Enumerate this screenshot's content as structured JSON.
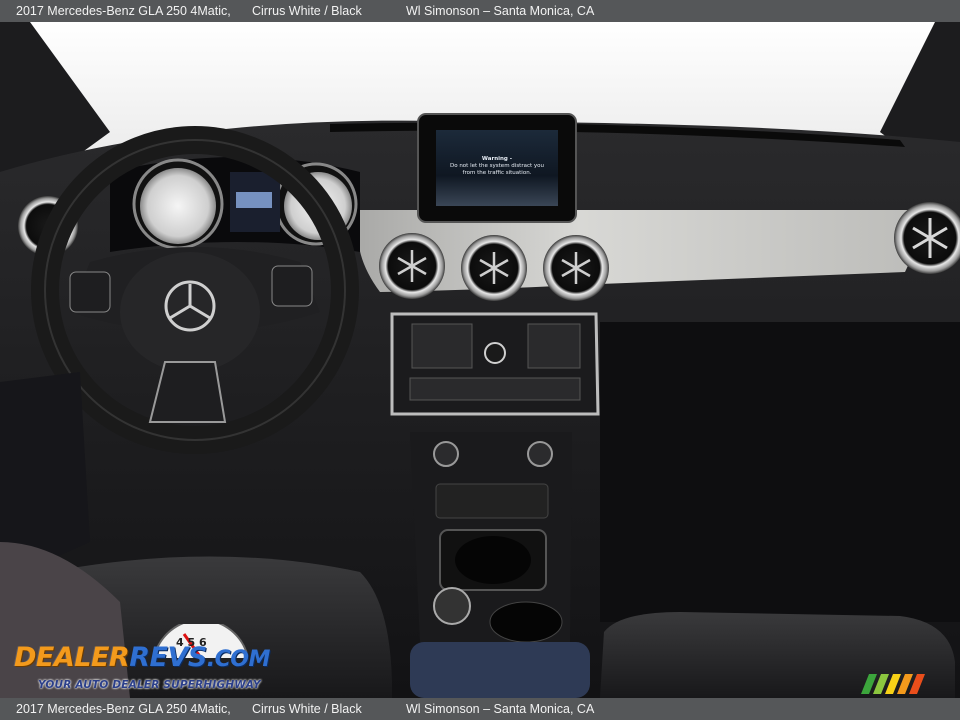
{
  "header": {
    "model": "2017 Mercedes-Benz GLA 250 4Matic,",
    "color": "Cirrus White / Black",
    "dealer": "Wl Simonson – Santa Monica, CA"
  },
  "footer": {
    "model": "2017 Mercedes-Benz GLA 250 4Matic,",
    "color": "Cirrus White / Black",
    "dealer": "Wl Simonson – Santa Monica, CA"
  },
  "screen": {
    "line1": "Warning -",
    "line2": "Do not let the system distract you",
    "line3": "from the traffic situation."
  },
  "watermark": {
    "logo_part1": "Dealer",
    "logo_part2": "Revs",
    "logo_part3": ".com",
    "tagline": "YOUR AUTO DEALER SUPERHIGHWAY",
    "gauge_digits": "4 5 6"
  },
  "colors": {
    "bar_bg": "#555759",
    "dash_silver": "#c9c9c7",
    "logo_orange": "#f39a1c",
    "logo_blue": "#2f6fd1"
  }
}
